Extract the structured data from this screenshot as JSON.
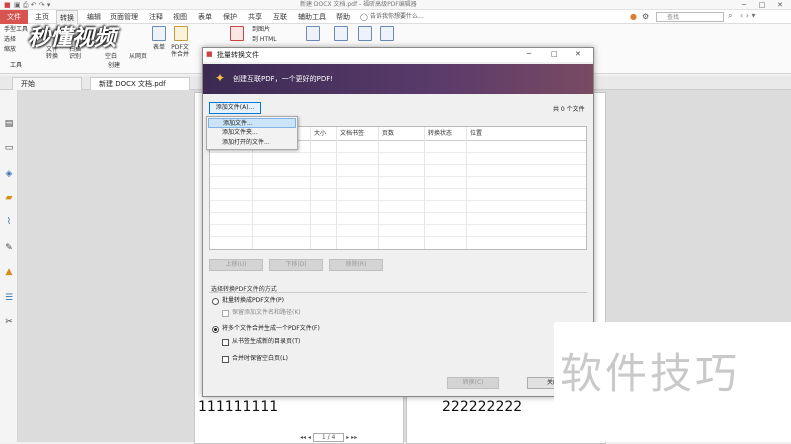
{
  "window": {
    "title": "新建 DOCX 文档.pdf - 福昕高级PDF编辑器"
  },
  "menu": {
    "file": "文件",
    "tabs": [
      "主页",
      "转换",
      "编辑",
      "页面管理",
      "注释",
      "视图",
      "表单",
      "保护",
      "共享",
      "互联",
      "辅助工具",
      "帮助"
    ],
    "tell_me": "告诉我你想要什么...",
    "search_placeholder": "查找"
  },
  "ribbon": {
    "left_tools": [
      "手型工具",
      "选择",
      "缩放"
    ],
    "tools_group": "工具",
    "file_convert": "文件转换",
    "scan": "扫描",
    "ocr": "识别",
    "create": "创建",
    "blank": "空白",
    "from_web": "从网页",
    "form": "表单",
    "pdf_file": "PDF文件合并",
    "to_image": "到图片",
    "to_html": "到 HTML"
  },
  "doc_tabs": [
    "开始",
    "新建 DOCX 文档.pdf"
  ],
  "logo_text": "秒懂视频",
  "dialog": {
    "title": "批量转换文件",
    "banner": "创建互联PDF，一个更好的PDF!",
    "add_files_button": "添加文件(A)...",
    "file_count": "共 0 个文件",
    "columns": [
      "大小",
      "文档书签",
      "页数",
      "转换状态",
      "位置"
    ],
    "dropdown_items": [
      "添加文件...",
      "添加文件夹...",
      "添加打开的文件..."
    ],
    "move_up": "上移(U)",
    "move_down": "下移(D)",
    "remove": "移除(R)",
    "method_group": "选择转换PDF文件的方式",
    "option_batch": "批量转换成PDF文件(P)",
    "option_keep_names": "保留添加文件名和路径(K)",
    "option_merge": "将多个文件合并生成一个PDF文件(F)",
    "option_bookmarks": "从书签生成新的目录页(T)",
    "option_blank_pages": "合并时保留空白页(L)",
    "convert_button": "转换(C)",
    "close_button": "关闭"
  },
  "pages": {
    "left_text": "111111111",
    "right_text": "222222222"
  },
  "status": {
    "page_indicator": "1 / 4"
  },
  "watermark": "软件技巧"
}
